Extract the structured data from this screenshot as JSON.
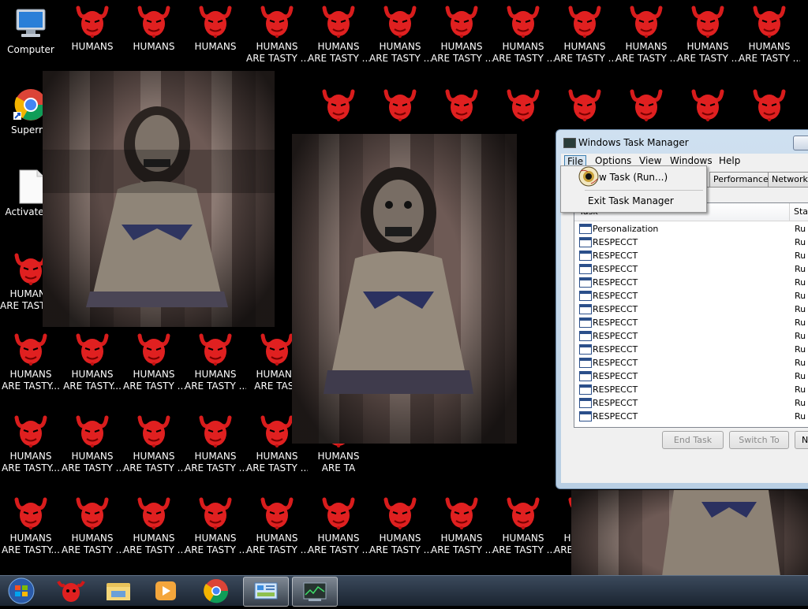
{
  "desktop": {
    "system_icons": [
      {
        "label": "Computer",
        "icon": "computer-icon"
      },
      {
        "label": "Supermi",
        "icon": "chrome-shortcut-icon"
      },
      {
        "label": "ActivatedA",
        "icon": "blank-document-icon"
      }
    ],
    "malware_icon": {
      "icon": "red-devil-icon",
      "color": "#e02020"
    },
    "icon_labels": {
      "row1": [
        "HUMANS",
        "HUMANS",
        "HUMANS",
        "HUMANS\nARE TASTY ...",
        "HUMANS\nARE TASTY ...",
        "HUMANS\nARE TASTY ...",
        "HUMANS\nARE TASTY ...",
        "HUMANS\nARE TASTY ...",
        "HUMANS\nARE TASTY ...",
        "HUMANS\nARE TASTY ...",
        "HUMANS\nARE TASTY ...",
        "HUMANS\nARE TASTY ..."
      ],
      "col1": [
        "HUMANS\nARE TASTY ...",
        "HUMANS\nARE TASTY...",
        "HUMANS\nARE TASTY...",
        "HUMANS\nARE TASTY..."
      ],
      "row4": [
        "HUMANS\nARE TASTY...",
        "HUMANS\nARE TASTY ...",
        "HUMANS\nARE TASTY ...",
        "HUMANS\nARE TAST"
      ],
      "row5": [
        "HUMANS\nARE TASTY ...",
        "HUMANS\nARE TASTY ...",
        "HUMANS\nARE TASTY ...",
        "HUMANS\nARE TASTY ...",
        "HUMANS\nARE TA"
      ],
      "row6": [
        "HUMANS\nARE TASTY ...",
        "HUMANS\nARE TASTY ...",
        "HUMANS\nARE TASTY ...",
        "HUMANS\nARE TASTY ...",
        "HUMANS\nARE TASTY ...",
        "HUMANS\nARE TASTY ...",
        "HUMANS\nARE TASTY ...",
        "HUMANS\nARE TASTY ...",
        "HUMANS\nARE TASTY ...",
        "H\nARE"
      ]
    },
    "partial_labels": [
      "AN",
      "AST",
      "AN",
      "AST",
      "AN",
      "AST",
      "AN",
      "AST",
      "S",
      "..."
    ]
  },
  "task_manager": {
    "title": "Windows Task Manager",
    "menu": [
      "File",
      "Options",
      "View",
      "Windows",
      "Help"
    ],
    "file_menu": {
      "new_task": "New Task (Run...)",
      "new_task_visible": "w Task (Run...)",
      "exit": "Exit Task Manager"
    },
    "tabs": [
      "Performance",
      "Networking"
    ],
    "tab_labels_visible": [
      "Performance",
      "Networkin"
    ],
    "columns": {
      "task": "Task",
      "status": "Sta"
    },
    "rows": [
      {
        "name": "Personalization",
        "status": "Ru"
      },
      {
        "name": "RESPECCT",
        "status": "Ru"
      },
      {
        "name": "RESPECCT",
        "status": "Ru"
      },
      {
        "name": "RESPECCT",
        "status": "Ru"
      },
      {
        "name": "RESPECCT",
        "status": "Ru"
      },
      {
        "name": "RESPECCT",
        "status": "Ru"
      },
      {
        "name": "RESPECCT",
        "status": "Ru"
      },
      {
        "name": "RESPECCT",
        "status": "Ru"
      },
      {
        "name": "RESPECCT",
        "status": "Ru"
      },
      {
        "name": "RESPECCT",
        "status": "Ru"
      },
      {
        "name": "RESPECCT",
        "status": "Ru"
      },
      {
        "name": "RESPECCT",
        "status": "Ru"
      },
      {
        "name": "RESPECCT",
        "status": "Ru"
      },
      {
        "name": "RESPECCT",
        "status": "Ru"
      },
      {
        "name": "RESPECCT",
        "status": "Ru"
      }
    ],
    "buttons": {
      "end_task": "End Task",
      "switch_to": "Switch To",
      "new_task": "Ne"
    }
  },
  "taskbar": {
    "items": [
      {
        "icon": "windows-start-orb-icon"
      },
      {
        "icon": "red-devil-icon"
      },
      {
        "icon": "file-explorer-icon"
      },
      {
        "icon": "media-player-icon"
      },
      {
        "icon": "chrome-icon"
      },
      {
        "icon": "control-panel-icon"
      },
      {
        "icon": "task-manager-icon"
      }
    ]
  }
}
